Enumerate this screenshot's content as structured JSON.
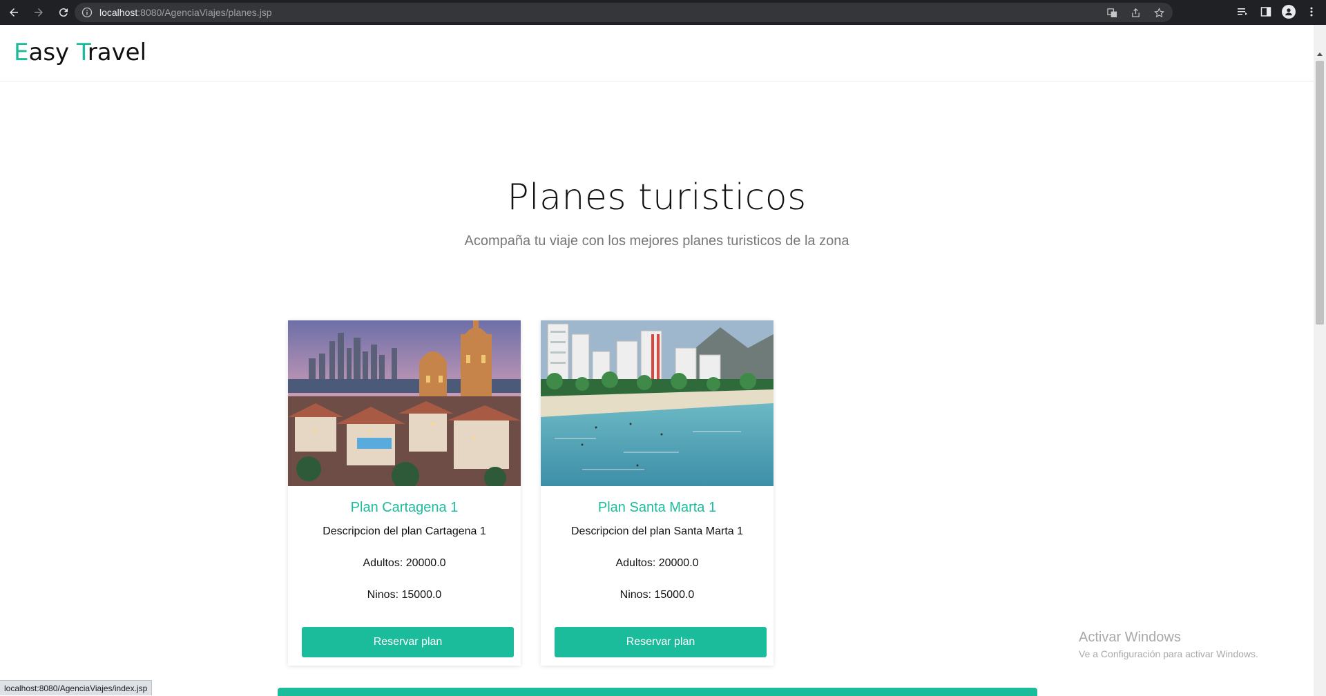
{
  "browser": {
    "url_host": "localhost",
    "url_rest": ":8080/AgenciaViajes/planes.jsp"
  },
  "site": {
    "logo_first_initial": "E",
    "logo_first_rest": "asy",
    "logo_second_initial": "T",
    "logo_second_rest": "ravel",
    "accent_color": "#1abc9c"
  },
  "hero": {
    "title": "Planes turisticos",
    "subtitle": "Acompaña tu viaje con los mejores planes turisticos de la zona"
  },
  "plans": [
    {
      "title": "Plan Cartagena 1",
      "description": "Descripcion del plan Cartagena 1",
      "adults": "Adultos: 20000.0",
      "kids": "Ninos: 15000.0",
      "button_label": "Reservar plan"
    },
    {
      "title": "Plan Santa Marta 1",
      "description": "Descripcion del plan Santa Marta 1",
      "adults": "Adultos: 20000.0",
      "kids": "Ninos: 15000.0",
      "button_label": "Reservar plan"
    }
  ],
  "watermark": {
    "line1": "Activar Windows",
    "line2": "Ve a Configuración para activar Windows."
  },
  "status_bar": "localhost:8080/AgenciaViajes/index.jsp"
}
